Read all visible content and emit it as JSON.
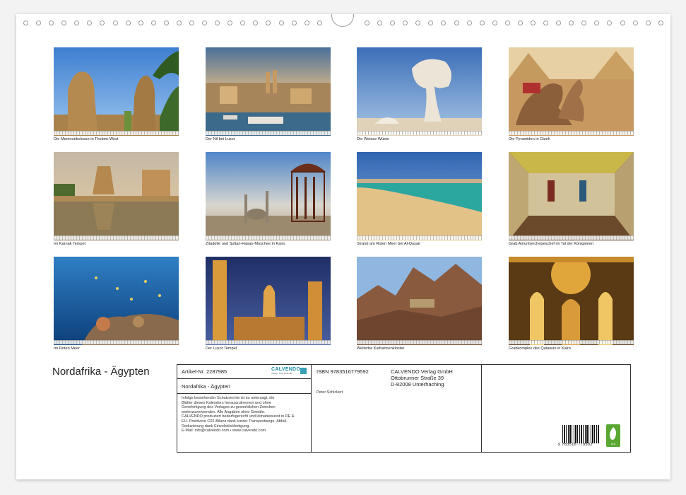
{
  "calendar": {
    "title": "Nordafrika - Ägypten",
    "tiles": [
      {
        "caption": "Die Memnonkolosse in Theben-West",
        "scene": "colossi"
      },
      {
        "caption": "Der Nil bei Luxor",
        "scene": "nile"
      },
      {
        "caption": "Die Weisse Wüste",
        "scene": "desert"
      },
      {
        "caption": "Die Pyramiden in Gizeh",
        "scene": "pyramids"
      },
      {
        "caption": "Im Karnak Tempel",
        "scene": "karnak"
      },
      {
        "caption": "Zitadelle und Sultan-Hasan-Moschee in Kairo",
        "scene": "cairo"
      },
      {
        "caption": "Strand am Roten Meer bei Al-Qusair",
        "scene": "beach"
      },
      {
        "caption": "Grab Amunherchepeschef im Tal der Königinnen",
        "scene": "tomb"
      },
      {
        "caption": "Im Roten Meer",
        "scene": "reef"
      },
      {
        "caption": "Der Luxor Tempel",
        "scene": "luxor"
      },
      {
        "caption": "Welterbe Katharinenkloster",
        "scene": "sinai"
      },
      {
        "caption": "Grabkomplex des Qalawun in Kairo",
        "scene": "qalawun"
      }
    ]
  },
  "info": {
    "article": "Artikel-Nr. 2287985",
    "logo_text": "CALVENDO",
    "logo_sub": "Verlag · Dein Kalender",
    "title": "Nordafrika - Ägypten",
    "legal": [
      "Infolge bestehender Schutzrechte ist es untersagt, die",
      "Blätter dieses Kalenders herauszutrennen und ohne",
      "Genehmigung des Verlages zu gewerblichen Zwecken",
      "weiterzuverwenden. Alle Angaben ohne Gewähr.",
      "CALVENDO produziert bedarfsgerecht und klimabewusst in DE &",
      "EU. Positivere C02-Bilanz dank kurzer Transportwege. Abfall-",
      "Reduzierung dank Einzelstückfertigung.",
      "E-Mail: info@calvendo.com • www.calvendo.com"
    ],
    "isbn": "ISBN 9783516779592",
    "author": "Peter Schickert",
    "publisher": "CALVENDO Verlag GmbH",
    "street": "Ottobrunner Straße 39",
    "city": "D-82008 Unterhaching",
    "barcode_number": "9 783516 779592",
    "eco_label": "eco"
  },
  "colors": {
    "paper": "#ffffff",
    "background": "#f3f3f3",
    "eco": "#5aa832",
    "brand": "#1d8fa8"
  }
}
